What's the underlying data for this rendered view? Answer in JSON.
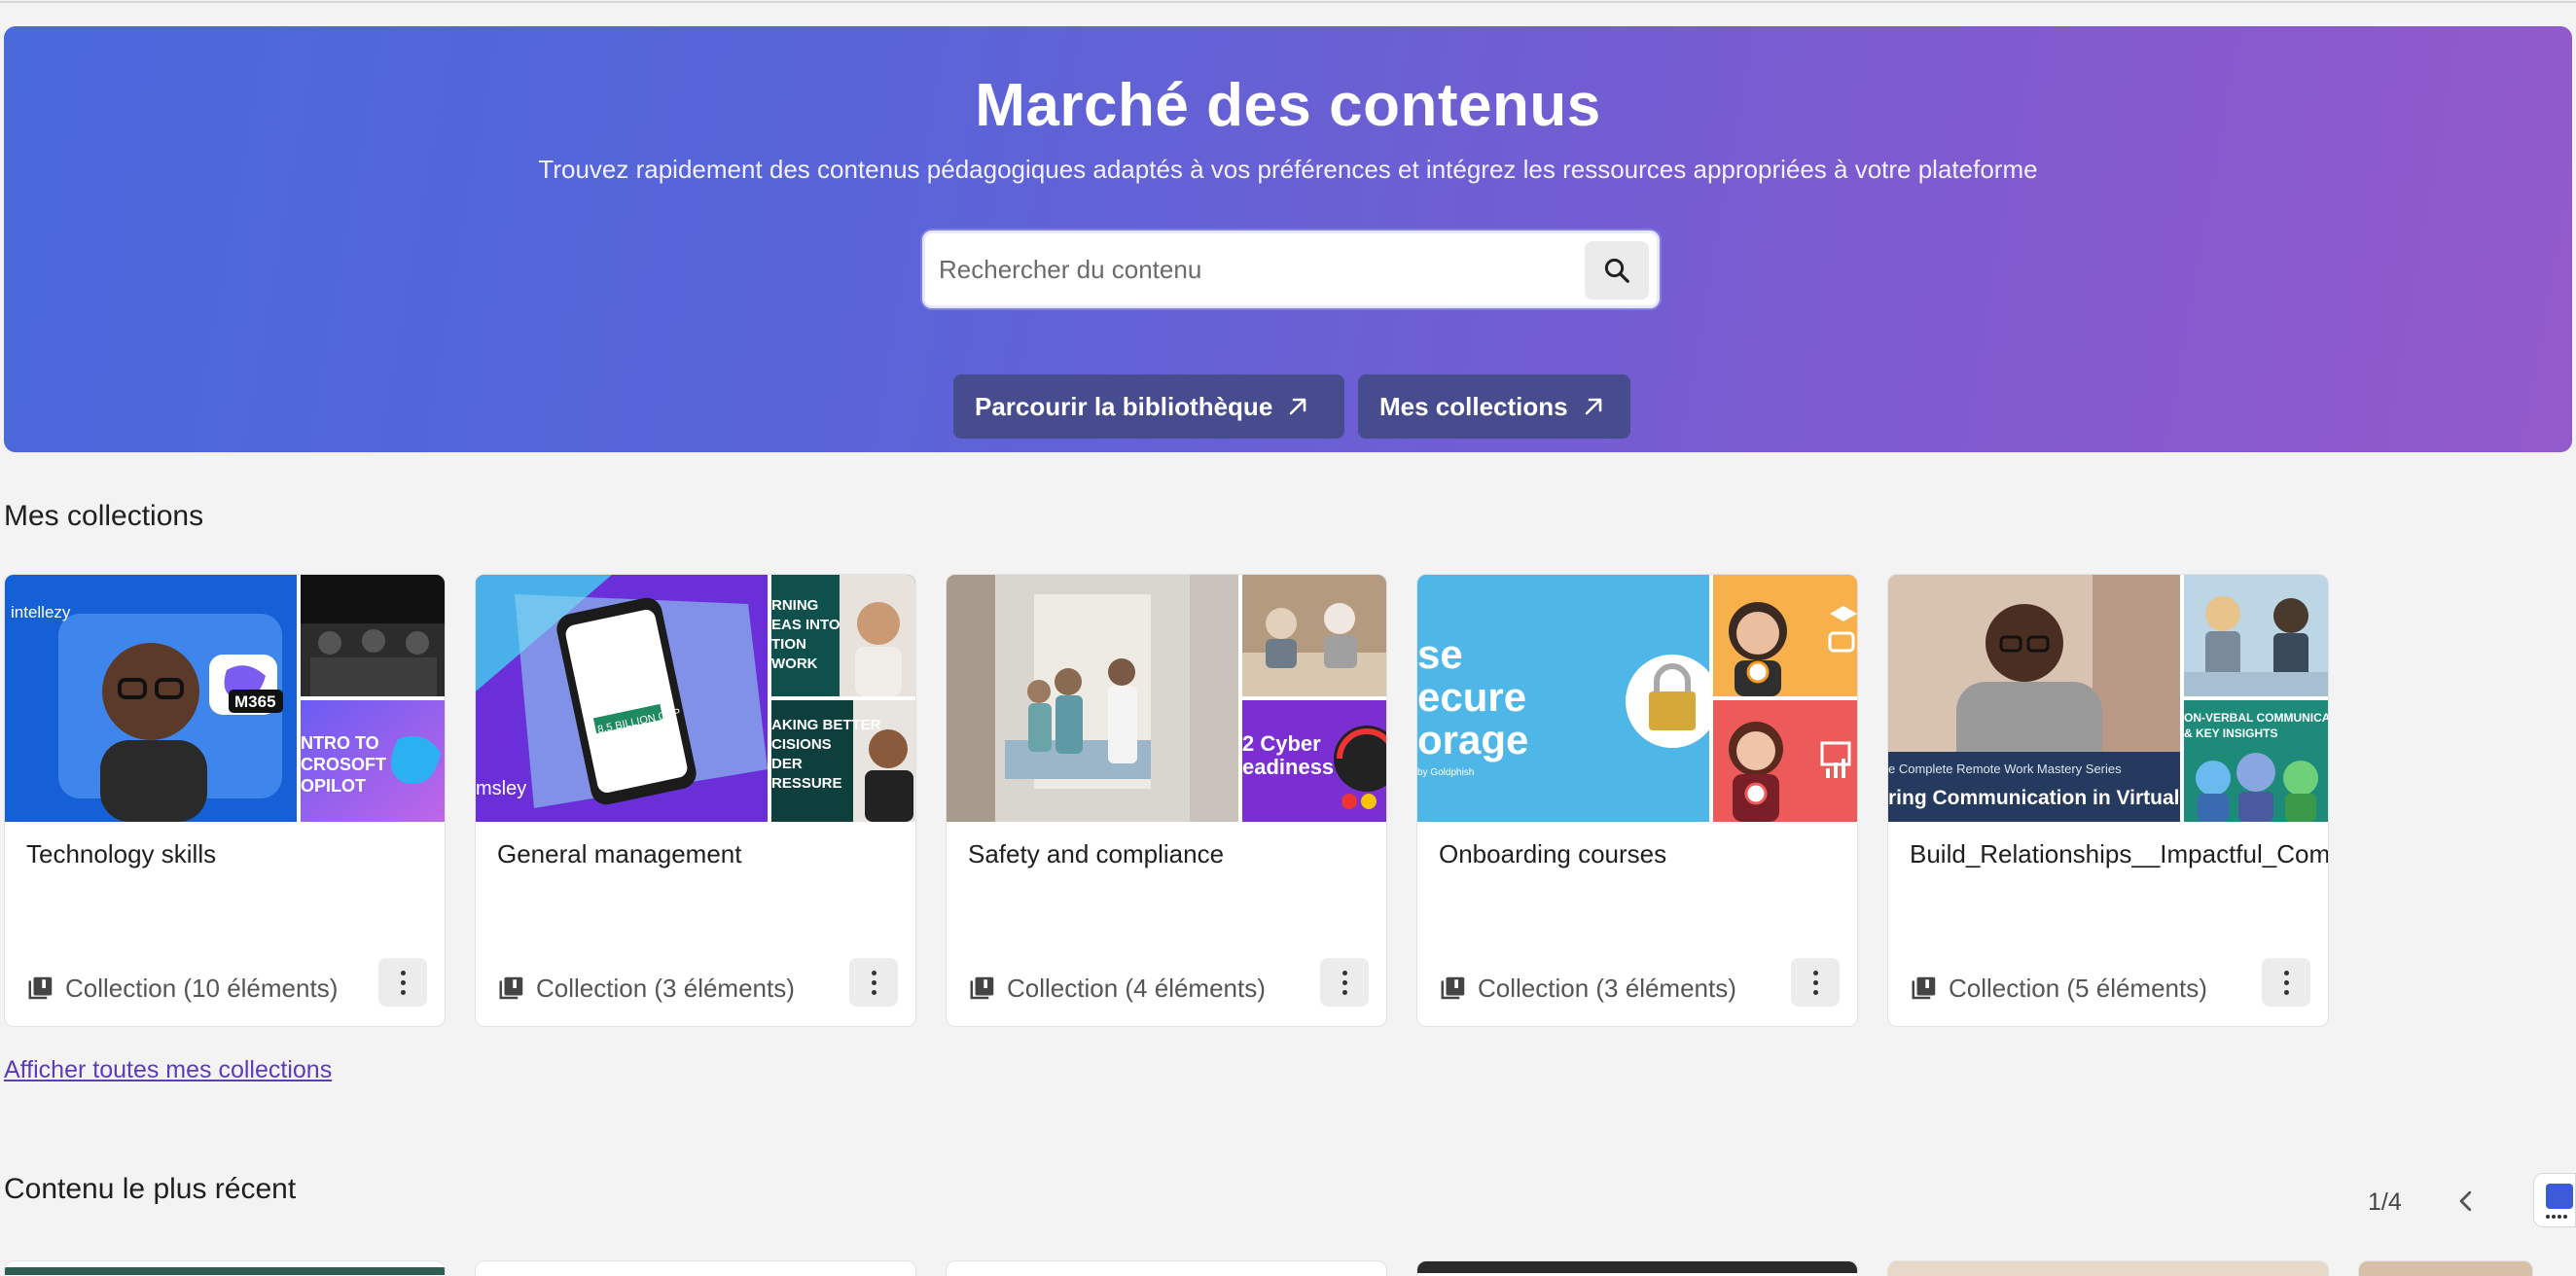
{
  "hero": {
    "title": "Marché des contenus",
    "subtitle": "Trouvez rapidement des contenus pédagogiques adaptés à vos préférences et intégrez les ressources appropriées à votre plateforme",
    "search_placeholder": "Rechercher du contenu",
    "browse_label": "Parcourir la bibliothèque",
    "collections_label": "Mes collections"
  },
  "collections_section": {
    "title": "Mes collections",
    "cards": [
      {
        "title": "Technology skills",
        "meta": "Collection (10 éléments)"
      },
      {
        "title": "General management",
        "meta": "Collection (3 éléments)"
      },
      {
        "title": "Safety and compliance",
        "meta": "Collection (4 éléments)"
      },
      {
        "title": "Onboarding courses",
        "meta": "Collection (3 éléments)"
      },
      {
        "title": "Build_Relationships__Impactful_Com",
        "meta": "Collection (5 éléments)"
      }
    ],
    "show_all_label": "Afficher toutes mes collections"
  },
  "thumb_text": {
    "c1_brand": "intellezy",
    "c1_badge": "M365",
    "c1_side": "NTRO TO\nCROSOFT\nOPILOT",
    "c2_top": "RNING\nEAS INTO\nTION\nWORK",
    "c2_bottom": "AKING BETTER\nCISIONS\nDER\nRESSURE",
    "c2_brand": "msley",
    "c2_phone": "8.5 BILLION GBP",
    "c3_side": "2 Cyber\neadiness",
    "c4_main": "se\necure\norage",
    "c4_brand": "by Goldphish",
    "c5_banner_top": "e Complete Remote Work Mastery Series",
    "c5_banner": "ring Communication in Virtual T",
    "c5_side": "ON-VERBAL COMMUNICATIO\n& KEY INSIGHTS"
  },
  "recent_section": {
    "title": "Contenu le plus récent",
    "pager": "1/4"
  },
  "colors": {
    "hero_start": "#4a69dc",
    "hero_end": "#935acb",
    "hero_button": "#474c8f",
    "link": "#5b3db8"
  }
}
